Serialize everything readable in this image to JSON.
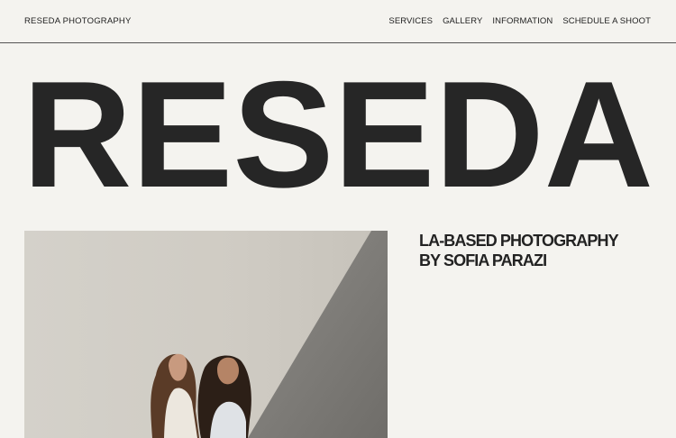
{
  "header": {
    "brand": "RESEDA PHOTOGRAPHY",
    "nav": [
      "SERVICES",
      "GALLERY",
      "INFORMATION",
      "SCHEDULE A SHOOT"
    ]
  },
  "hero": {
    "wordmark": "RESEDA"
  },
  "intro": {
    "tagline_line1": "LA-BASED PHOTOGRAPHY",
    "tagline_line2": "BY SOFIA PARAZI"
  },
  "colors": {
    "background": "#f4f3ef",
    "text": "#262626"
  }
}
